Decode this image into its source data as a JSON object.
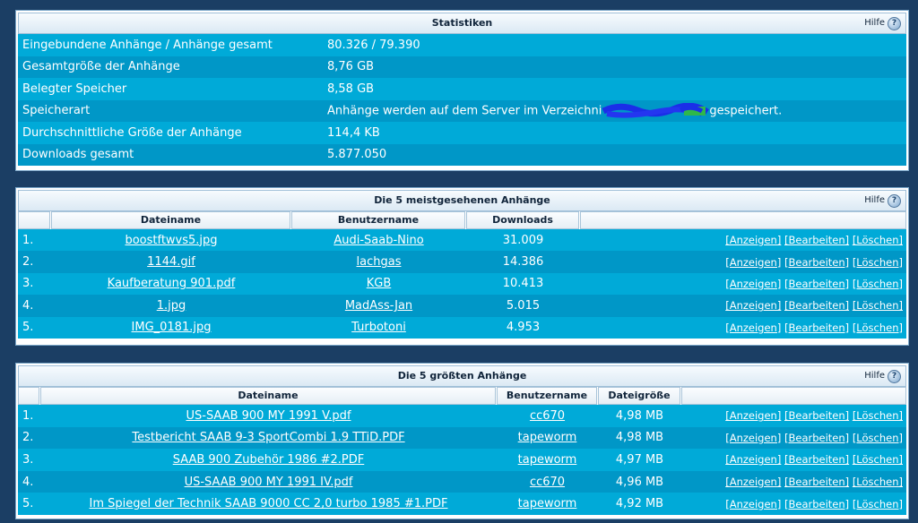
{
  "help_label": "Hilfe",
  "help_icon": "question-mark-icon",
  "stats": {
    "title": "Statistiken",
    "rows": [
      {
        "label": "Eingebundene Anhänge / Anhänge gesamt",
        "value": "80.326 / 79.390"
      },
      {
        "label": "Gesamtgröße der Anhänge",
        "value": "8,76 GB"
      },
      {
        "label": "Belegter Speicher",
        "value": "8,58 GB"
      },
      {
        "label": "Speicherart",
        "value_pre": "Anhänge werden auf dem Server im Verzeichni",
        "value_post": "gespeichert."
      },
      {
        "label": "Durchschnittliche Größe der Anhänge",
        "value": "114,4 KB"
      },
      {
        "label": "Downloads gesamt",
        "value": "5.877.050"
      }
    ]
  },
  "actions": {
    "view": "[Anzeigen]",
    "edit": "[Bearbeiten]",
    "delete": "[Löschen]"
  },
  "most_viewed": {
    "title": "Die 5 meistgesehenen Anhänge",
    "columns": [
      "Dateiname",
      "Benutzername",
      "Downloads"
    ],
    "rows": [
      {
        "num": "1.",
        "file": "boostftwvs5.jpg",
        "user": "Audi-Saab-Nino",
        "value": "31.009"
      },
      {
        "num": "2.",
        "file": "1144.gif",
        "user": "lachgas",
        "value": "14.386"
      },
      {
        "num": "3.",
        "file": "Kaufberatung 901.pdf",
        "user": "KGB",
        "value": "10.413"
      },
      {
        "num": "4.",
        "file": "1.jpg",
        "user": "MadAss-Jan",
        "value": "5.015"
      },
      {
        "num": "5.",
        "file": "IMG_0181.jpg",
        "user": "Turbotoni",
        "value": "4.953"
      }
    ]
  },
  "largest": {
    "title": "Die 5 größten Anhänge",
    "columns": [
      "Dateiname",
      "Benutzername",
      "Dateigröße"
    ],
    "rows": [
      {
        "num": "1.",
        "file": "US-SAAB 900 MY 1991 V.pdf",
        "user": "cc670",
        "value": "4,98 MB"
      },
      {
        "num": "2.",
        "file": "Testbericht SAAB 9-3 SportCombi 1.9 TTiD.PDF",
        "user": "tapeworm",
        "value": "4,98 MB"
      },
      {
        "num": "3.",
        "file": "SAAB 900 Zubehör 1986 #2.PDF",
        "user": "tapeworm",
        "value": "4,97 MB"
      },
      {
        "num": "4.",
        "file": "US-SAAB 900 MY 1991 IV.pdf",
        "user": "cc670",
        "value": "4,96 MB"
      },
      {
        "num": "5.",
        "file": "Im Spiegel der Technik SAAB 9000 CC 2,0 turbo 1985 #1.PDF",
        "user": "tapeworm",
        "value": "4,92 MB"
      }
    ]
  }
}
